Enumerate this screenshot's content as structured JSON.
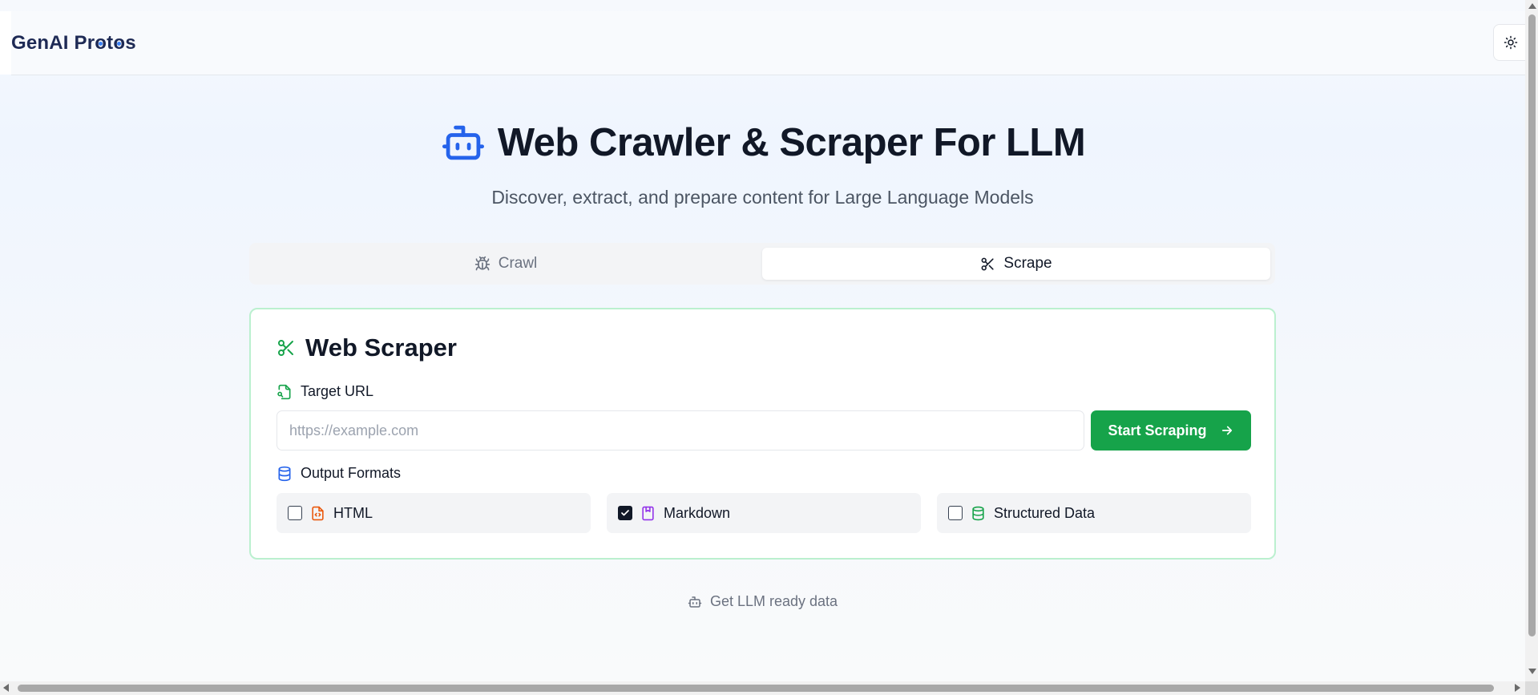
{
  "app": {
    "brand": "GenAI Protos"
  },
  "header": {
    "theme_toggle_icon": "sun-icon"
  },
  "hero": {
    "title": "Web Crawler & Scraper For LLM",
    "subtitle": "Discover, extract, and prepare content for Large Language Models",
    "title_icon": "bot-icon"
  },
  "tabs": [
    {
      "label": "Crawl",
      "icon": "bug-icon",
      "active": false
    },
    {
      "label": "Scrape",
      "icon": "scissors-icon",
      "active": true
    }
  ],
  "scraper": {
    "title": "Web Scraper",
    "url_label": "Target URL",
    "url_value": "",
    "url_placeholder": "https://example.com",
    "start_button": "Start Scraping",
    "formats_label": "Output Formats",
    "formats": [
      {
        "label": "HTML",
        "checked": false,
        "color": "#ea580c"
      },
      {
        "label": "Markdown",
        "checked": true,
        "color": "#9333ea"
      },
      {
        "label": "Structured Data",
        "checked": false,
        "color": "#16a34a"
      }
    ]
  },
  "footer": {
    "note": "Get LLM ready data"
  },
  "colors": {
    "accent_blue": "#2563eb",
    "accent_green": "#16a34a",
    "card_border": "#bbf0cf"
  }
}
